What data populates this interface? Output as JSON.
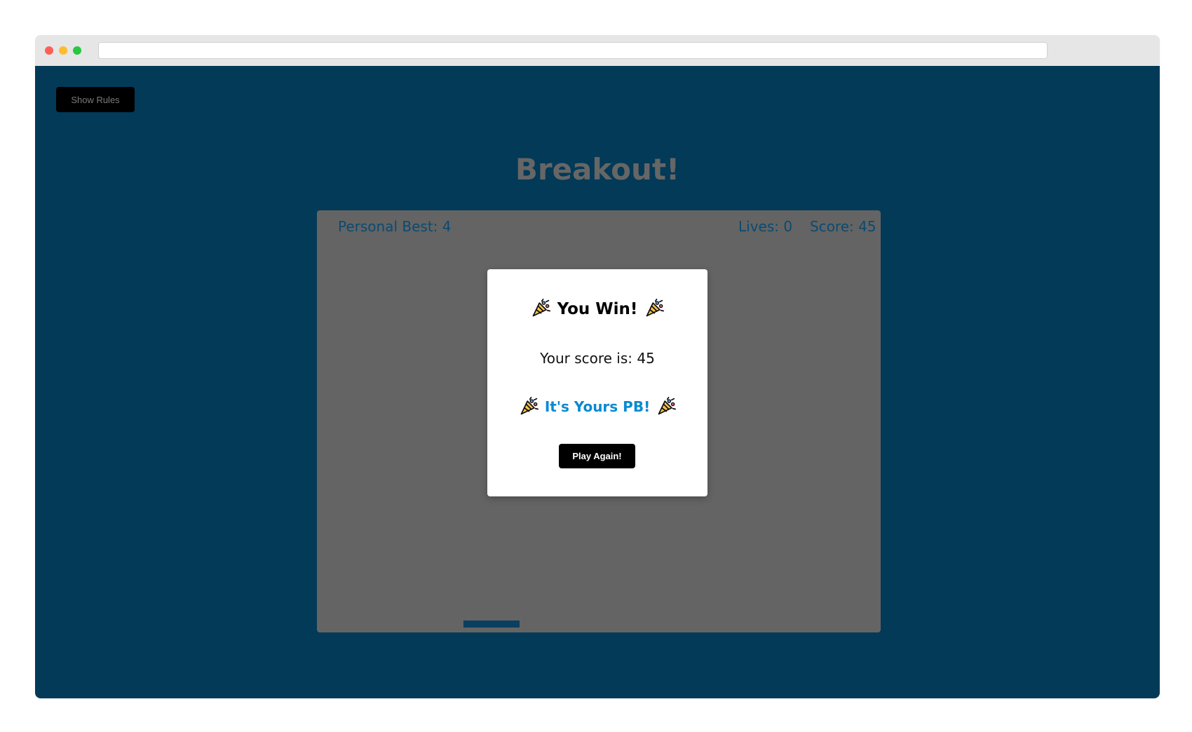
{
  "colors": {
    "page_background": "#ffffff",
    "browser_chrome": "#e6e6e6",
    "game_background": "#023a58",
    "board_background": "#646464",
    "hud_text": "#0b4a70",
    "title_text": "#666666",
    "modal_background": "#ffffff",
    "pb_text": "#0a8ad1",
    "button_background": "#000000"
  },
  "toolbar": {
    "rules_button": "Show Rules"
  },
  "game": {
    "title": "Breakout!",
    "personal_best": "Personal Best: 4",
    "lives": "Lives: 0",
    "score": "Score: 45"
  },
  "modal": {
    "title": "You Win!",
    "score_text": "Your score is: 45",
    "pb_text": "It's Yours PB!",
    "play_button": "Play Again!"
  },
  "icons": {
    "celebration": "party-popper-icon"
  }
}
